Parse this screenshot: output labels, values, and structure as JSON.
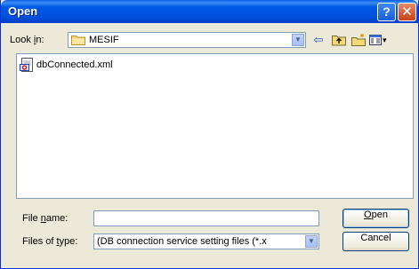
{
  "window": {
    "title": "Open",
    "help_glyph": "?",
    "close_glyph": "✕"
  },
  "look_in": {
    "label_pre": "Look ",
    "label_accel": "i",
    "label_post": "n:",
    "value": "MESIF"
  },
  "toolbar": {
    "icons": [
      "back-icon",
      "up-folder-icon",
      "new-folder-icon",
      "view-menu-icon"
    ],
    "back_glyph": "⇦",
    "view_caret": "▾"
  },
  "files": [
    {
      "name": "dbConnected.xml",
      "icon": "xml-file-icon"
    }
  ],
  "file_name": {
    "label_pre": "File ",
    "label_accel": "n",
    "label_post": "ame:",
    "value": "",
    "placeholder": ""
  },
  "files_of_type": {
    "label_pre": "Files of ",
    "label_accel": "t",
    "label_post": "ype:",
    "value": "(DB connection service setting files (*.x"
  },
  "buttons": {
    "open_accel": "O",
    "open_rest": "pen",
    "cancel": "Cancel"
  },
  "colors": {
    "titlebar": "#0054e3",
    "dialog_bg": "#ece9d8",
    "field_border": "#7f9db9",
    "close_button": "#c8421a"
  }
}
